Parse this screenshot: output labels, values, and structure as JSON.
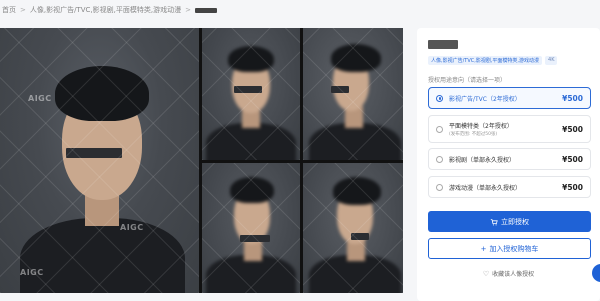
{
  "breadcrumb": {
    "items": [
      "首页",
      "人像,影视广告/TVC,影视剧,平面模特类,游戏动漫"
    ],
    "sep": ">"
  },
  "gallery": {
    "watermark": "AIGC"
  },
  "panel": {
    "tags": [
      "人像,影视广告/TVC,影视剧,平面模特类,游戏动漫",
      "4K"
    ],
    "section_label": "授权用途意向（请选择一项）",
    "options": [
      {
        "label": "影视广告/TVC（2年授权）",
        "sub": "",
        "price": "¥500",
        "selected": true
      },
      {
        "label": "平面模特类（2年授权）",
        "sub": "(发布范围: 不超过50张)",
        "price": "¥500",
        "selected": false
      },
      {
        "label": "影视剧（单部永久授权）",
        "sub": "",
        "price": "¥500",
        "selected": false
      },
      {
        "label": "游戏动漫（单部永久授权）",
        "sub": "",
        "price": "¥500",
        "selected": false
      }
    ],
    "buy_label": "立即授权",
    "cart_label": "加入授权购物车",
    "fav_label": "收藏该人像授权"
  },
  "colors": {
    "accent": "#1f62d6",
    "page_bg": "#f5f6f8"
  },
  "icons": {
    "cart": "cart-icon",
    "plus": "plus-icon",
    "heart": "heart-icon"
  }
}
